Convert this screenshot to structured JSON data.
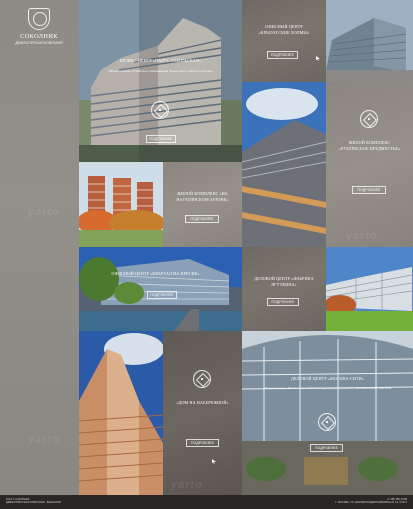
{
  "brand": {
    "name": "СОКОЛНИК",
    "tagline": "ДЕВЕЛОПЕРСКАЯ КОМПАНИЯ"
  },
  "tiles": {
    "business_center_parus": {
      "title": "БИЗНЕС-ЦЕНТР «ПАРУС ТОБОЛЬСКАЯ»",
      "text": "Общая площадь: 65 000 кв.м. Современный бизнес-центр класса А в Москве",
      "button": "ПОДРОБНЕЕ"
    },
    "office_krylatskie": {
      "title": "ОФИСНЫЙ ЦЕНТР «КРЫЛАТСКИЕ ХОЛМЫ»",
      "button": "ПОДРОБНЕЕ"
    },
    "residential_rublevskoe": {
      "title": "ЖИЛОЙ КОМПЛЕКС «РУБЛЁВСКОЕ ПРЕДМЕСТЬЕ»",
      "button": "ПОДРОБНЕЕ"
    },
    "residential_nagatinsky": {
      "title": "ЖИЛОЙ КОМПЛЕКС «НА НАГАТИНСКОМ ЗАТОНЕ»",
      "button": "ПОДРОБНЕЕ"
    },
    "office_kvartal": {
      "title": "ОФИСНЫЙ ЦЕНТР «КВАРТАЛ НА ПРЕСНЕ»",
      "button": "ПОДРОБНЕЕ"
    },
    "business_fabrika": {
      "title": "ДЕЛОВОЙ ЦЕНТР «ФАБРИКА ЯГУТКИНА»",
      "button": "ПОДРОБНЕЕ"
    },
    "dom_na_naberezhnoy": {
      "title": "«ДОМ НА НАБЕРЕЖНОЙ»",
      "button": "ПОДРОБНЕЕ"
    },
    "business_moscow_city": {
      "title": "ДЕЛОВОЙ ЦЕНТР «МОСКВА-СИТИ»",
      "text": "Общая площадь: 415 кв.м. Крупнейший международный деловой и развлекательный комплекс",
      "button": "ПОДРОБНЕЕ"
    }
  },
  "footer": {
    "left_line1": "2014 © СОКОЛНИК",
    "left_line2": "ДЕВЕЛОПЕРСКАЯ КОМПАНИЯ · ВАКАНСИИ",
    "right_line1": "+7 495 786 25 88",
    "right_line2": "Г. МОСКВА, УЛ. ШАРИКОПОДШИПНИКОВСКАЯ, 13, СТР. 2"
  },
  "colors": {
    "accent": "#ffffff",
    "footer_bg": "#292624"
  }
}
